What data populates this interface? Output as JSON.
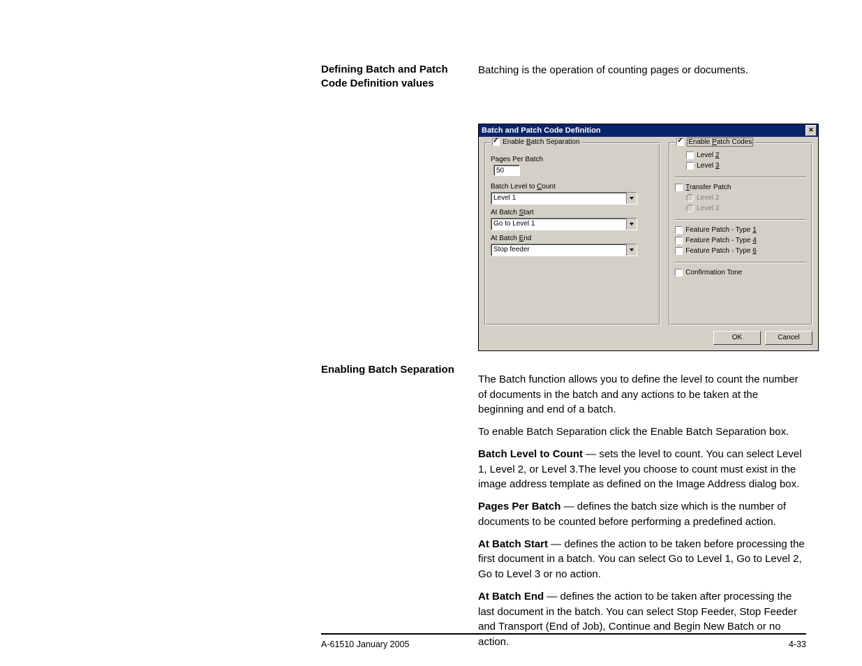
{
  "headings": {
    "section1": "Defining Batch and Patch Code Definition values",
    "section2": "Enabling Batch Separation"
  },
  "intro": "Batching is the operation of counting pages or documents.",
  "dialog": {
    "title": "Batch and Patch Code Definition",
    "close_glyph": "✕",
    "left": {
      "enable_batch_separation": "Enable Batch Separation",
      "pages_per_batch_label": "Pages Per Batch",
      "pages_per_batch_value": "50",
      "batch_level_to_count_label": "Batch Level to Count",
      "batch_level_to_count_value": "Level 1",
      "at_batch_start_label": "At Batch Start",
      "at_batch_start_value": "Go to Level 1",
      "at_batch_end_label": "At Batch End",
      "at_batch_end_value": "Stop feeder"
    },
    "right": {
      "enable_patch_codes": "Enable Patch Codes",
      "level2": "Level 2",
      "level3": "Level 3",
      "transfer_patch": "Transfer Patch",
      "tp_level2": "Level 2",
      "tp_level3": "Level 3",
      "feature_patch_1": "Feature Patch - Type 1",
      "feature_patch_4": "Feature Patch - Type 4",
      "feature_patch_6": "Feature Patch - Type 6",
      "confirmation_tone": "Confirmation Tone"
    },
    "buttons": {
      "ok": "OK",
      "cancel": "Cancel"
    }
  },
  "body": {
    "p1": "The Batch function allows you to define the level to count the number of documents in the batch and any actions to be taken at the beginning and end of a batch.",
    "p2": "To enable Batch Separation click the Enable Batch Separation box.",
    "p3_term": "Batch Level to Count",
    "p3_em": " — ",
    "p3_rest": "sets the level to count. You can select Level 1, Level 2, or Level 3.The level you choose to count must exist in the image address template as defined on the Image Address dialog box.",
    "p4_term": "Pages Per Batch",
    "p4_em": " — ",
    "p4_rest": "defines the batch size which is the number of documents to be counted before performing a predefined action.",
    "p5_term": "At Batch Start",
    "p5_em": " — ",
    "p5_rest": "defines the action to be taken before processing the first document in a batch. You can select Go to Level 1, Go to Level 2, Go to Level 3 or no action.",
    "p6_term": "At Batch End",
    "p6_em": " — ",
    "p6_rest": "defines the action to be taken after processing the last document in the batch. You can select Stop Feeder, Stop Feeder and Transport (End of Job), Continue and Begin New Batch or no action."
  },
  "footer": {
    "left": "A-61510 January 2005",
    "right": "4-33"
  }
}
